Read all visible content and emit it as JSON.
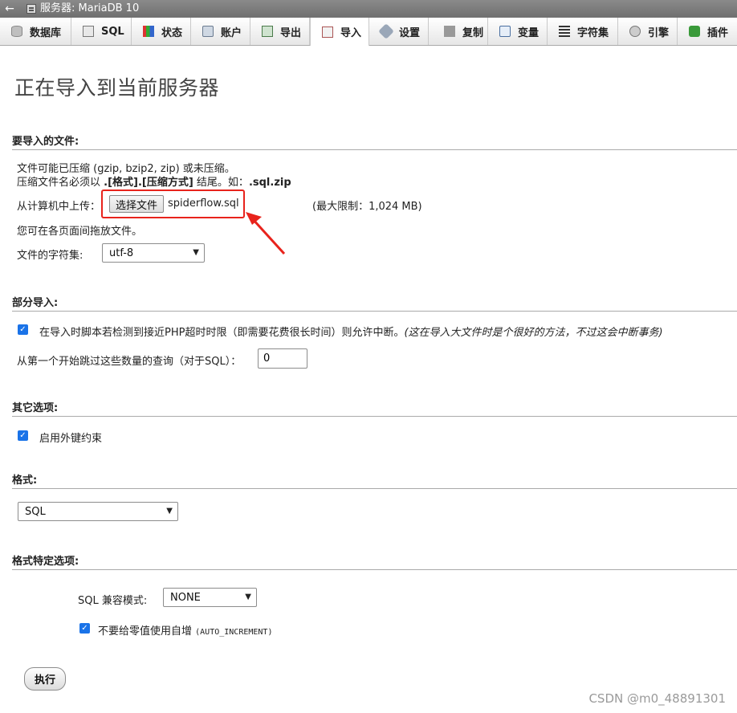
{
  "titlebar": {
    "back": "←",
    "title": "服务器: MariaDB 10"
  },
  "tabs": [
    {
      "label": "数据库",
      "icon": "database-icon"
    },
    {
      "label": "SQL",
      "icon": "sql-icon"
    },
    {
      "label": "状态",
      "icon": "status-icon"
    },
    {
      "label": "账户",
      "icon": "users-icon"
    },
    {
      "label": "导出",
      "icon": "export-icon"
    },
    {
      "label": "导入",
      "icon": "import-icon",
      "active": true
    },
    {
      "label": "设置",
      "icon": "settings-icon"
    },
    {
      "label": "复制",
      "icon": "replication-icon"
    },
    {
      "label": "变量",
      "icon": "variables-icon"
    },
    {
      "label": "字符集",
      "icon": "charsets-icon"
    },
    {
      "label": "引擎",
      "icon": "engines-icon"
    },
    {
      "label": "插件",
      "icon": "plugins-icon"
    }
  ],
  "page_title": "正在导入到当前服务器",
  "file_section": {
    "legend": "要导入的文件:",
    "compress_note": "文件可能已压缩 (gzip, bzip2, zip) 或未压缩。",
    "name_note_pre": "压缩文件名必须以 ",
    "name_note_bold": ".[格式].[压缩方式]",
    "name_note_mid": " 结尾。如：",
    "name_note_example": ".sql.zip",
    "upload_label": "从计算机中上传：",
    "choose_button": "选择文件",
    "file_name": "spiderflow.sql",
    "max_limit": "(最大限制：1,024 MB)",
    "drag_note": "您可在各页面间拖放文件。",
    "charset_label": "文件的字符集:",
    "charset_value": "utf-8"
  },
  "partial_section": {
    "legend": "部分导入:",
    "allow_interrupt": "在导入时脚本若检测到接近PHP超时时限（即需要花费很长时间）则允许中断。",
    "allow_interrupt_note": "(这在导入大文件时是个很好的方法，不过这会中断事务)",
    "skip_label": "从第一个开始跳过这些数量的查询（对于SQL）：",
    "skip_value": "0"
  },
  "other_section": {
    "legend": "其它选项:",
    "foreign_keys": "启用外键约束"
  },
  "format_section": {
    "legend": "格式:",
    "format_value": "SQL"
  },
  "format_options": {
    "legend": "格式特定选项:",
    "compat_label": "SQL 兼容模式:",
    "compat_value": "NONE",
    "no_auto_value_pre": "不要给零值使用自增 ",
    "no_auto_value_code": "(AUTO_INCREMENT)"
  },
  "go_button": "执行",
  "watermark": "CSDN @m0_48891301",
  "colors": {
    "annotation_red": "#e8231c",
    "checkbox_blue": "#1a73e8"
  }
}
